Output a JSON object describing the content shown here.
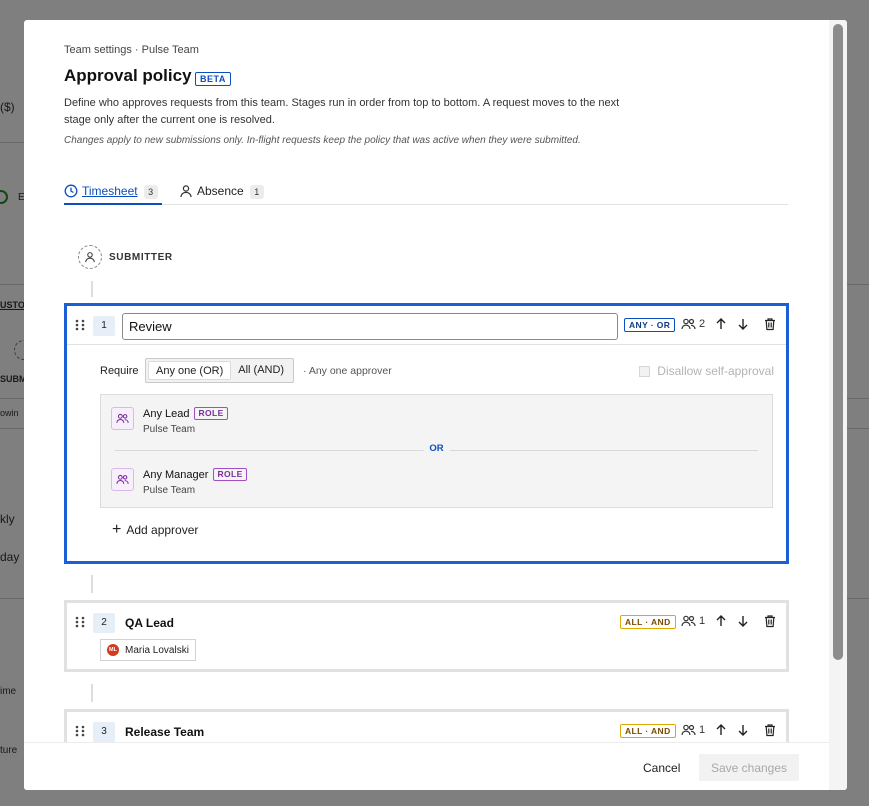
{
  "background": {
    "fragments": [
      "($)",
      "E",
      "USTO",
      "SUBM",
      "owin",
      "kly",
      "day",
      "ime",
      "ture"
    ]
  },
  "modal": {
    "breadcrumb": "Team settings · Pulse Team",
    "title": "Approval policy",
    "beta": "BETA",
    "description": "Define who approves requests from this team. Stages run in order from top to bottom. A request moves to the next stage only after the current one is resolved.",
    "note": "Changes apply to new submissions only. In-flight requests keep the policy that was active when they were submitted."
  },
  "tabs": [
    {
      "label": "Timesheet",
      "count": "3",
      "icon": "clock-icon",
      "selected": true
    },
    {
      "label": "Absence",
      "count": "1",
      "icon": "person-icon",
      "selected": false
    }
  ],
  "submitter": {
    "label": "SUBMITTER"
  },
  "stages": [
    {
      "number": "1",
      "name": "Review",
      "mode": "ANY · OR",
      "approver_count": "2",
      "require_label": "Require",
      "options": [
        "Any one (OR)",
        "All (AND)"
      ],
      "selected_option": "Any one (OR)",
      "hint": "· Any one approver",
      "self_approval": "Disallow self-approval",
      "approvers": [
        {
          "name": "Any Lead",
          "badge": "ROLE",
          "team": "Pulse Team"
        },
        {
          "name": "Any Manager",
          "badge": "ROLE",
          "team": "Pulse Team"
        }
      ],
      "separator": "OR",
      "add_label": "Add approver"
    },
    {
      "number": "2",
      "name": "QA Lead",
      "mode": "ALL · AND",
      "approver_count": "1",
      "person": {
        "initials": "ML",
        "name": "Maria Lovalski"
      }
    },
    {
      "number": "3",
      "name": "Release Team",
      "mode": "ALL · AND",
      "approver_count": "1"
    }
  ],
  "footer": {
    "cancel": "Cancel",
    "save": "Save changes"
  },
  "colors": {
    "accent": "#1a5fd6",
    "or_mode": "#0b4fbd",
    "and_mode": "#e0a800",
    "role": "#a24fc7"
  }
}
